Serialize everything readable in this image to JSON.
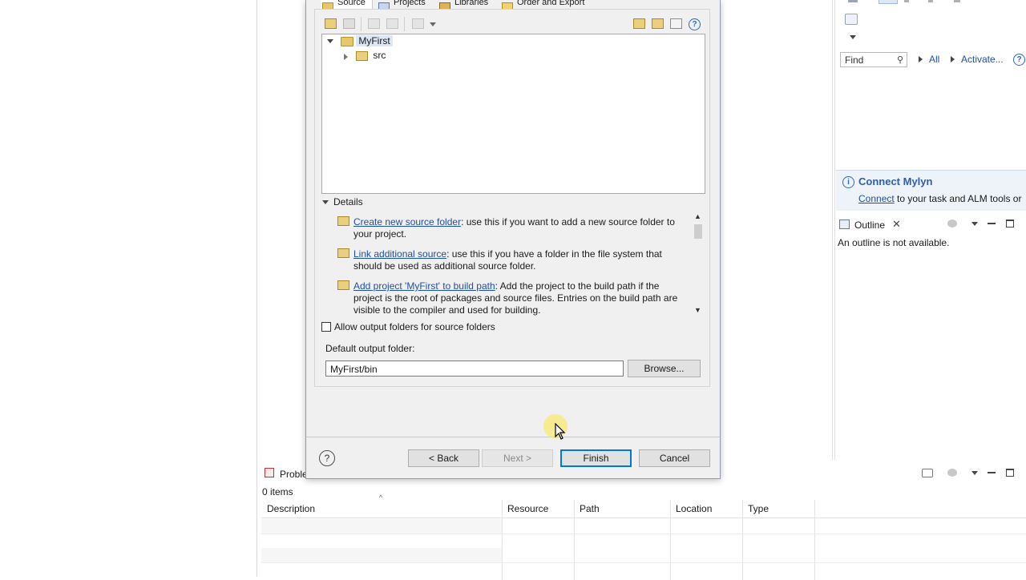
{
  "right_pane": {
    "find_placeholder": "Find",
    "all_label": "All",
    "activate_label": "Activate...",
    "mylyn": {
      "title": "Connect Mylyn",
      "link": "Connect",
      "text": " to your task and ALM tools or"
    },
    "outline": {
      "tab": "Outline",
      "message": "An outline is not available."
    }
  },
  "problems": {
    "tab": "Proble",
    "count": "0 items",
    "columns": [
      "Description",
      "Resource",
      "Path",
      "Location",
      "Type"
    ]
  },
  "dialog": {
    "tabs": [
      {
        "label": "Source",
        "icon": "source-folder-icon"
      },
      {
        "label": "Projects",
        "icon": "projects-icon"
      },
      {
        "label": "Libraries",
        "icon": "libraries-icon"
      },
      {
        "label": "Order and Export",
        "icon": "order-export-icon"
      }
    ],
    "tree": {
      "project": "MyFirst",
      "children": [
        "src"
      ]
    },
    "details": {
      "title": "Details",
      "items": [
        {
          "link": "Create new source folder",
          "text": ": use this if you want to add a new source folder to your project."
        },
        {
          "link": "Link additional source",
          "text": ": use this if you have a folder in the file system that should be used as additional source folder."
        },
        {
          "link": "Add project 'MyFirst' to build path",
          "text": ": Add the project to the build path if the project is the root of packages and source files. Entries on the build path are visible to the compiler and used for building."
        }
      ]
    },
    "allow_output_label": "Allow output folders for source folders",
    "allow_output_checked": false,
    "output_folder_label": "Default output folder:",
    "output_folder_value": "MyFirst/bin",
    "browse_label": "Browse...",
    "buttons": {
      "help": "?",
      "back": "< Back",
      "next": "Next >",
      "finish": "Finish",
      "cancel": "Cancel"
    }
  }
}
